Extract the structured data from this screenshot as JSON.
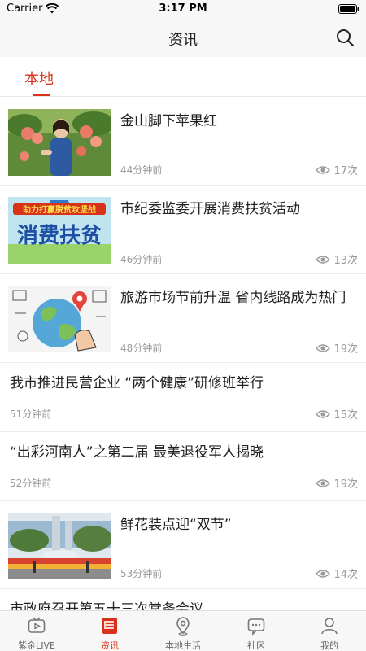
{
  "status": {
    "carrier": "Carrier",
    "time": "3:17 PM"
  },
  "header": {
    "title": "资讯"
  },
  "tabs": [
    {
      "label": "本地"
    }
  ],
  "news": [
    {
      "title": "金山脚下苹果红",
      "time": "44分钟前",
      "views": "17次",
      "has_image": true,
      "image": "apple-orchard"
    },
    {
      "title": "市纪委监委开展消费扶贫活动",
      "time": "46分钟前",
      "views": "13次",
      "has_image": true,
      "image": "poverty-banner",
      "image_text_top": "助力打赢脱贫攻坚战",
      "image_text_main": "消费扶贫"
    },
    {
      "title": "旅游市场节前升温 省内线路成为热门",
      "time": "48分钟前",
      "views": "19次",
      "has_image": true,
      "image": "travel-globe"
    },
    {
      "title": "我市推进民营企业 “两个健康”研修班举行",
      "time": "51分钟前",
      "views": "15次",
      "has_image": false
    },
    {
      "title": "“出彩河南人”之第二届 最美退役军人揭晓",
      "time": "52分钟前",
      "views": "19次",
      "has_image": false
    },
    {
      "title": "鲜花装点迎“双节”",
      "time": "53分钟前",
      "views": "14次",
      "has_image": true,
      "image": "flower-square"
    },
    {
      "title": "市政府召开第五十三次常务会议",
      "time": "",
      "views": "",
      "has_image": false
    }
  ],
  "bottom_tabs": [
    {
      "label": "紫金LIVE",
      "icon": "tv-icon",
      "active": false
    },
    {
      "label": "资讯",
      "icon": "news-icon",
      "active": true
    },
    {
      "label": "本地生活",
      "icon": "location-icon",
      "active": false
    },
    {
      "label": "社区",
      "icon": "chat-icon",
      "active": false
    },
    {
      "label": "我的",
      "icon": "user-icon",
      "active": false
    }
  ],
  "colors": {
    "accent": "#d8321b",
    "bar_bg": "#f7f7f7",
    "meta_text": "#9a9a9a"
  }
}
